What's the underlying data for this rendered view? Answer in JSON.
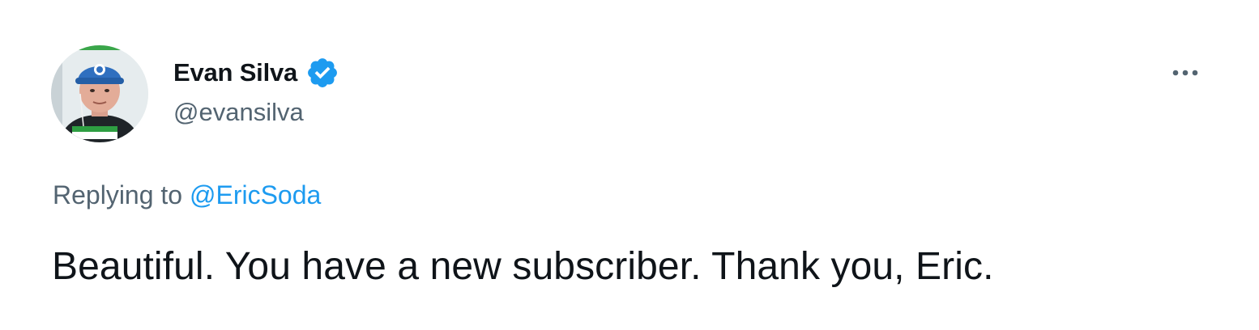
{
  "author": {
    "display_name": "Evan Silva",
    "handle": "@evansilva",
    "verified": true,
    "avatar_caption": "EVAN SILVA"
  },
  "icons": {
    "verified": "verified-badge-icon",
    "more": "more-horizontal-icon"
  },
  "reply": {
    "prefix": "Replying to ",
    "mention": "@EricSoda"
  },
  "tweet": {
    "text": "Beautiful. You have a new subscriber. Thank you, Eric."
  },
  "colors": {
    "text_primary": "#0f1419",
    "text_secondary": "#536471",
    "accent": "#1d9bf0"
  }
}
